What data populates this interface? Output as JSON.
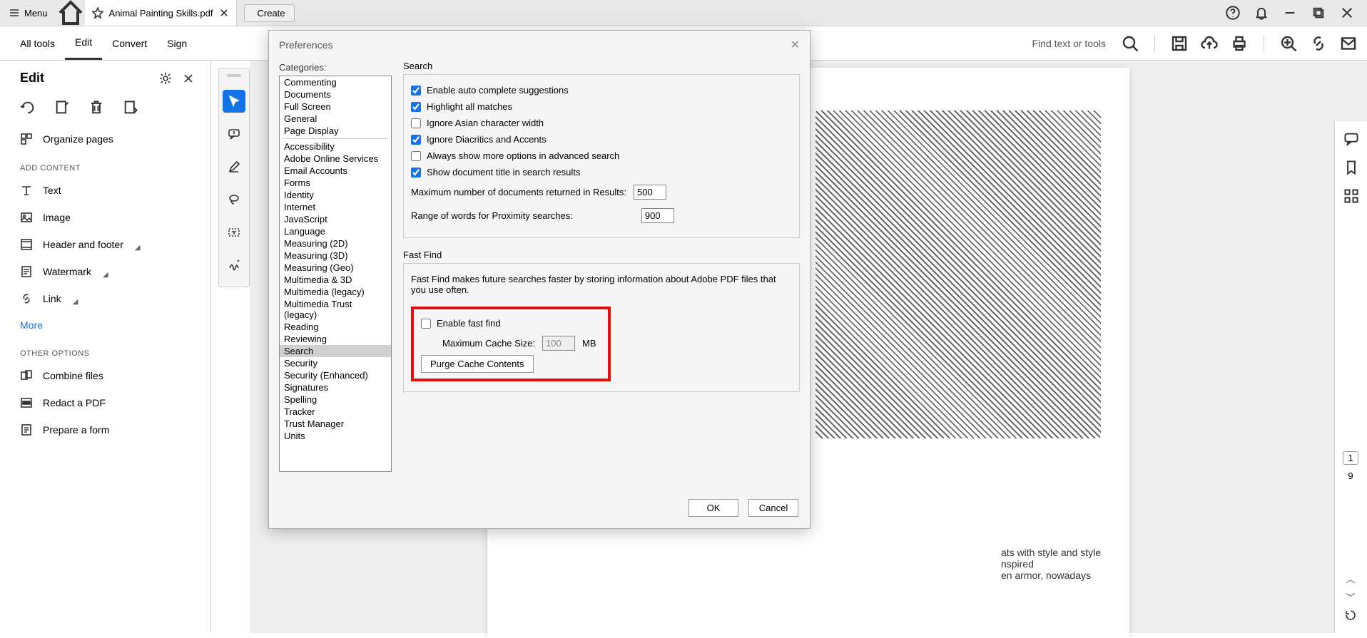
{
  "titlebar": {
    "menu": "Menu",
    "tab_title": "Animal Painting Skills.pdf",
    "create": "Create"
  },
  "toolbar": {
    "all_tools": "All tools",
    "edit": "Edit",
    "convert": "Convert",
    "sign": "Sign",
    "find": "Find text or tools"
  },
  "panel": {
    "title": "Edit",
    "organize": "Organize pages",
    "add_content": "ADD CONTENT",
    "text": "Text",
    "image": "Image",
    "header_footer": "Header and footer",
    "watermark": "Watermark",
    "link": "Link",
    "more": "More",
    "other_options": "OTHER OPTIONS",
    "combine": "Combine files",
    "redact": "Redact a PDF",
    "prepare": "Prepare a form"
  },
  "dialog": {
    "title": "Preferences",
    "categories_label": "Categories:",
    "categories_top": [
      "Commenting",
      "Documents",
      "Full Screen",
      "General",
      "Page Display"
    ],
    "categories_rest": [
      "Accessibility",
      "Adobe Online Services",
      "Email Accounts",
      "Forms",
      "Identity",
      "Internet",
      "JavaScript",
      "Language",
      "Measuring (2D)",
      "Measuring (3D)",
      "Measuring (Geo)",
      "Multimedia & 3D",
      "Multimedia (legacy)",
      "Multimedia Trust (legacy)",
      "Reading",
      "Reviewing",
      "Search",
      "Security",
      "Security (Enhanced)",
      "Signatures",
      "Spelling",
      "Tracker",
      "Trust Manager",
      "Units"
    ],
    "selected_category": "Search",
    "search_group": "Search",
    "cb_autocomplete": "Enable auto complete suggestions",
    "cb_highlight": "Highlight all matches",
    "cb_asian": "Ignore Asian character width",
    "cb_diacritics": "Ignore Diacritics and Accents",
    "cb_advanced": "Always show more options in advanced search",
    "cb_doctitle": "Show document title in search results",
    "max_docs_label": "Maximum number of documents returned in Results:",
    "max_docs_value": "500",
    "proximity_label": "Range of words for Proximity searches:",
    "proximity_value": "900",
    "fastfind_group": "Fast Find",
    "fastfind_desc": "Fast Find makes future searches faster by storing information about Adobe PDF files that you use often.",
    "cb_fastfind": "Enable fast find",
    "cache_label": "Maximum Cache Size:",
    "cache_value": "100",
    "cache_unit": "MB",
    "purge": "Purge Cache Contents",
    "ok": "OK",
    "cancel": "Cancel"
  },
  "doc": {
    "line1": "ats with style and style",
    "line2": "nspired",
    "line3": "en armor, nowadays"
  },
  "pages": {
    "current": "1",
    "total": "9"
  }
}
